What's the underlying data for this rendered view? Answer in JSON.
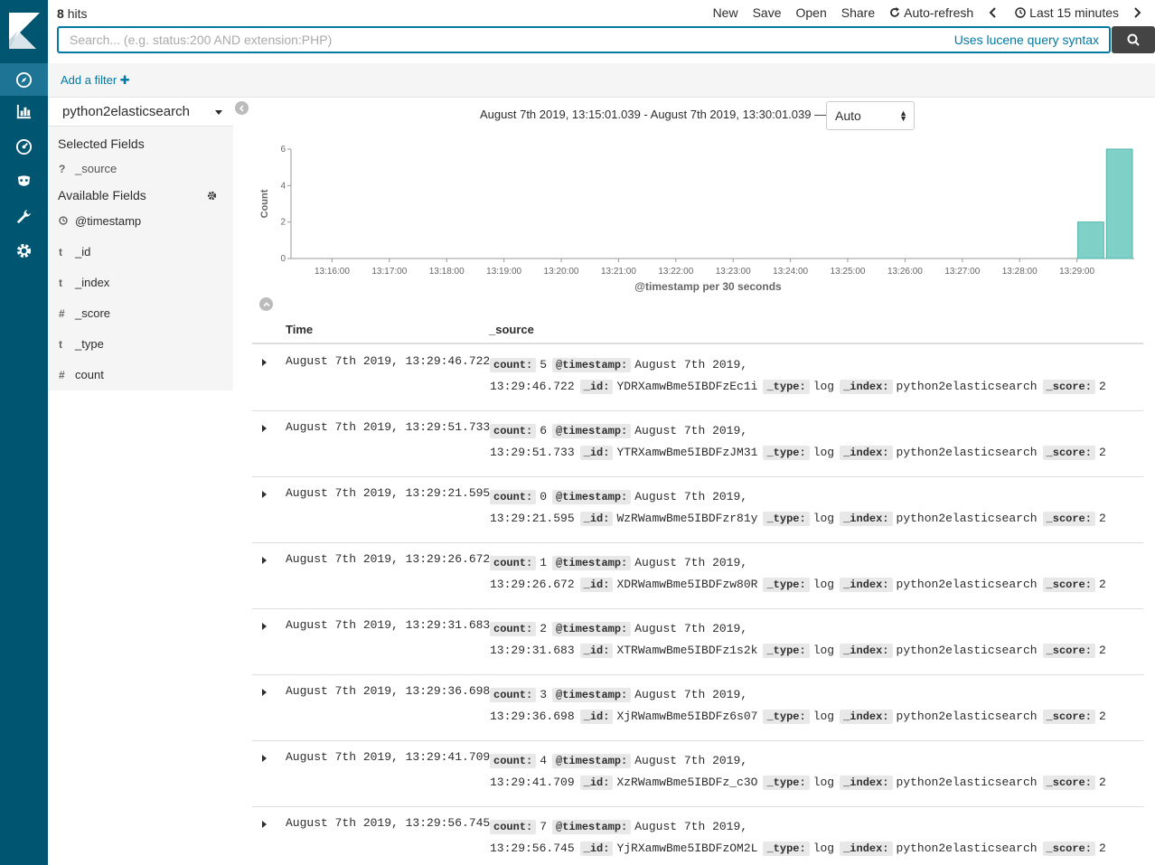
{
  "topbar": {
    "hits_count": "8",
    "hits_label": "hits",
    "menu": [
      "New",
      "Save",
      "Open",
      "Share"
    ],
    "auto_refresh": "Auto-refresh",
    "time_range": "Last 15 minutes"
  },
  "search": {
    "placeholder": "Search... (e.g. status:200 AND extension:PHP)",
    "syntax_hint": "Uses lucene query syntax"
  },
  "filter": {
    "add_label": "Add a filter ✚"
  },
  "sidebar": {
    "index_pattern": "python2elasticsearch",
    "selected_title": "Selected Fields",
    "selected_fields": [
      {
        "type": "?",
        "name": "_source"
      }
    ],
    "available_title": "Available Fields",
    "available_fields": [
      {
        "type": "clock",
        "name": "@timestamp"
      },
      {
        "type": "t",
        "name": "_id"
      },
      {
        "type": "t",
        "name": "_index"
      },
      {
        "type": "#",
        "name": "_score"
      },
      {
        "type": "t",
        "name": "_type"
      },
      {
        "type": "#",
        "name": "count"
      }
    ]
  },
  "histogram": {
    "date_range": "August 7th 2019, 13:15:01.039 - August 7th 2019, 13:30:01.039 —",
    "interval": "Auto"
  },
  "chart_data": {
    "type": "bar",
    "categories": [
      "13:16:00",
      "13:17:00",
      "13:18:00",
      "13:19:00",
      "13:20:00",
      "13:21:00",
      "13:22:00",
      "13:23:00",
      "13:24:00",
      "13:25:00",
      "13:26:00",
      "13:27:00",
      "13:28:00",
      "13:29:00"
    ],
    "bars": [
      {
        "x": "13:29:00",
        "value": 2
      },
      {
        "x": "13:29:30",
        "value": 6
      }
    ],
    "ylabel": "Count",
    "xlabel": "@timestamp per 30 seconds",
    "yticks": [
      0,
      2,
      4,
      6
    ],
    "ylim": [
      0,
      6
    ],
    "color": "#7fd1c8"
  },
  "table": {
    "col_time": "Time",
    "col_source": "_source",
    "rows": [
      {
        "time": "August 7th 2019, 13:29:46.722",
        "count": "5",
        "timestamp": "August 7th 2019, 13:29:46.722",
        "id": "YDRXamwBme5IBDFzEc1i",
        "type": "log",
        "index": "python2elasticsearch",
        "score": "2"
      },
      {
        "time": "August 7th 2019, 13:29:51.733",
        "count": "6",
        "timestamp": "August 7th 2019, 13:29:51.733",
        "id": "YTRXamwBme5IBDFzJM31",
        "type": "log",
        "index": "python2elasticsearch",
        "score": "2"
      },
      {
        "time": "August 7th 2019, 13:29:21.595",
        "count": "0",
        "timestamp": "August 7th 2019, 13:29:21.595",
        "id": "WzRWamwBme5IBDFzr81y",
        "type": "log",
        "index": "python2elasticsearch",
        "score": "2"
      },
      {
        "time": "August 7th 2019, 13:29:26.672",
        "count": "1",
        "timestamp": "August 7th 2019, 13:29:26.672",
        "id": "XDRWamwBme5IBDFzw80R",
        "type": "log",
        "index": "python2elasticsearch",
        "score": "2"
      },
      {
        "time": "August 7th 2019, 13:29:31.683",
        "count": "2",
        "timestamp": "August 7th 2019, 13:29:31.683",
        "id": "XTRWamwBme5IBDFz1s2k",
        "type": "log",
        "index": "python2elasticsearch",
        "score": "2"
      },
      {
        "time": "August 7th 2019, 13:29:36.698",
        "count": "3",
        "timestamp": "August 7th 2019, 13:29:36.698",
        "id": "XjRWamwBme5IBDFz6s07",
        "type": "log",
        "index": "python2elasticsearch",
        "score": "2"
      },
      {
        "time": "August 7th 2019, 13:29:41.709",
        "count": "4",
        "timestamp": "August 7th 2019, 13:29:41.709",
        "id": "XzRWamwBme5IBDFz_c3O",
        "type": "log",
        "index": "python2elasticsearch",
        "score": "2"
      },
      {
        "time": "August 7th 2019, 13:29:56.745",
        "count": "7",
        "timestamp": "August 7th 2019, 13:29:56.745",
        "id": "YjRXamwBme5IBDFzOM2L",
        "type": "log",
        "index": "python2elasticsearch",
        "score": "2"
      }
    ],
    "keys": {
      "count": "count:",
      "timestamp": "@timestamp:",
      "id": "_id:",
      "type": "_type:",
      "index": "_index:",
      "score": "_score:"
    }
  },
  "nav": {
    "items": [
      "discover-icon",
      "visualize-icon",
      "dashboard-icon",
      "timelion-icon",
      "dev-tools-icon",
      "management-icon"
    ]
  }
}
